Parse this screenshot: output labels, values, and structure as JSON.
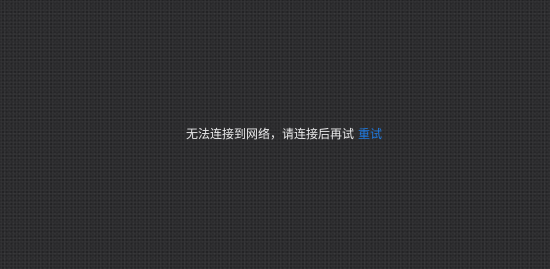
{
  "error": {
    "message": "无法连接到网络，请连接后再试",
    "retry_label": "重试"
  },
  "colors": {
    "background": "#2b2b2d",
    "text": "#e9e9ea",
    "link": "#1f7ae0"
  }
}
